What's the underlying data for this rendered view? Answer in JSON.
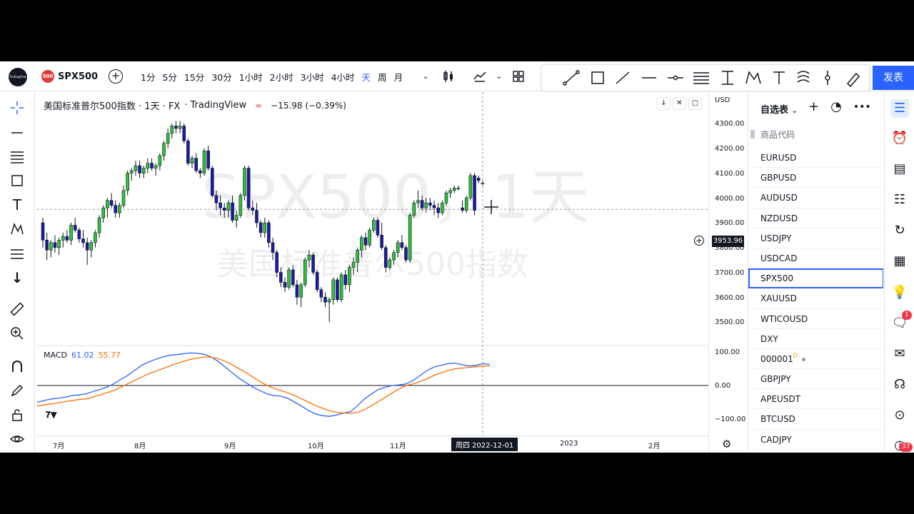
{
  "toolbar": {
    "logo_text": "TradingView",
    "symbol_badge": "500",
    "symbol": "SPX500",
    "intervals": [
      "1分",
      "5分",
      "15分",
      "30分",
      "1小时",
      "2小时",
      "3小时",
      "4小时",
      "天",
      "周",
      "月"
    ],
    "active_interval": "天",
    "publish_label": "发表"
  },
  "legend": {
    "title": "美国标准普尔500指数 · 1天 · FX",
    "source": "· TradingView",
    "change": "−15.98 (−0.39%)"
  },
  "watermark": {
    "line1": "SPX500，1天",
    "line2": "美国标准普尔500指数"
  },
  "macd": {
    "label": "MACD",
    "macd_value": "61.02",
    "signal_value": "55.77"
  },
  "price_axis": {
    "currency": "USD",
    "labels": [
      "4300.00",
      "4200.00",
      "4100.00",
      "4000.00",
      "3900.00",
      "3800.00",
      "3700.00",
      "3600.00",
      "3500.00"
    ],
    "current_price": "3953.96",
    "macd_labels": [
      "100.00",
      "0.00",
      "−100.00"
    ]
  },
  "time_axis": {
    "labels": [
      "7月",
      "8月",
      "9月",
      "10月",
      "11月",
      "2023",
      "2月"
    ],
    "crosshair_label": "周四 2022-12-01"
  },
  "watchlist": {
    "title": "自选表",
    "column_header": "商品代码",
    "items": [
      "EURUSD",
      "GBPUSD",
      "AUDUSD",
      "NZDUSD",
      "USDJPY",
      "USDCAD",
      "SPX500",
      "XAUUSD",
      "WTICOUSD",
      "DXY",
      "000001",
      "GBPJPY",
      "APEUSDT",
      "BTCUSD",
      "CADJPY"
    ],
    "selected": "SPX500",
    "flag_item_label": "D"
  },
  "rail": {
    "chat_badge": "1",
    "notif_badge": "37"
  },
  "colors": {
    "up": "#2ec338",
    "down": "#1a1aa6",
    "accent": "#2962ff",
    "macd": "#2962ff",
    "signal": "#ff6d00"
  },
  "chart_data": {
    "type": "candlestick",
    "title": "美国标准普尔500指数 · 1天 · FX",
    "ylim": [
      3450,
      4350
    ],
    "candles": [
      [
        3900,
        3920,
        3800,
        3830
      ],
      [
        3830,
        3860,
        3750,
        3790
      ],
      [
        3790,
        3830,
        3760,
        3820
      ],
      [
        3820,
        3850,
        3780,
        3800
      ],
      [
        3800,
        3840,
        3770,
        3830
      ],
      [
        3830,
        3860,
        3800,
        3845
      ],
      [
        3845,
        3870,
        3820,
        3830
      ],
      [
        3830,
        3900,
        3810,
        3890
      ],
      [
        3890,
        3920,
        3860,
        3870
      ],
      [
        3870,
        3880,
        3820,
        3835
      ],
      [
        3835,
        3870,
        3800,
        3820
      ],
      [
        3820,
        3840,
        3730,
        3790
      ],
      [
        3790,
        3830,
        3760,
        3820
      ],
      [
        3820,
        3870,
        3800,
        3860
      ],
      [
        3860,
        3930,
        3840,
        3920
      ],
      [
        3920,
        3970,
        3900,
        3960
      ],
      [
        3960,
        4000,
        3920,
        3990
      ],
      [
        3990,
        4020,
        3960,
        3970
      ],
      [
        3970,
        3990,
        3920,
        3940
      ],
      [
        3940,
        3980,
        3920,
        3970
      ],
      [
        3970,
        4050,
        3960,
        4030
      ],
      [
        4030,
        4110,
        4010,
        4100
      ],
      [
        4100,
        4120,
        4070,
        4110
      ],
      [
        4110,
        4150,
        4090,
        4130
      ],
      [
        4130,
        4150,
        4080,
        4100
      ],
      [
        4100,
        4130,
        4080,
        4120
      ],
      [
        4120,
        4160,
        4100,
        4140
      ],
      [
        4140,
        4160,
        4110,
        4120
      ],
      [
        4120,
        4140,
        4090,
        4130
      ],
      [
        4130,
        4180,
        4110,
        4170
      ],
      [
        4170,
        4230,
        4150,
        4220
      ],
      [
        4220,
        4280,
        4200,
        4260
      ],
      [
        4260,
        4300,
        4240,
        4290
      ],
      [
        4290,
        4310,
        4260,
        4280
      ],
      [
        4280,
        4310,
        4260,
        4290
      ],
      [
        4290,
        4300,
        4220,
        4230
      ],
      [
        4230,
        4240,
        4130,
        4140
      ],
      [
        4140,
        4170,
        4120,
        4160
      ],
      [
        4160,
        4180,
        4100,
        4110
      ],
      [
        4110,
        4120,
        4080,
        4100
      ],
      [
        4100,
        4200,
        4090,
        4190
      ],
      [
        4190,
        4210,
        4110,
        4120
      ],
      [
        4120,
        4130,
        4000,
        4010
      ],
      [
        4010,
        4030,
        3950,
        3980
      ],
      [
        3980,
        4010,
        3930,
        3960
      ],
      [
        3960,
        3980,
        3920,
        3950
      ],
      [
        3950,
        3990,
        3920,
        3980
      ],
      [
        3980,
        4010,
        3900,
        3910
      ],
      [
        3910,
        3950,
        3880,
        3930
      ],
      [
        3930,
        4020,
        3920,
        4010
      ],
      [
        4010,
        4130,
        3990,
        4120
      ],
      [
        4120,
        4130,
        3950,
        3960
      ],
      [
        3960,
        3990,
        3930,
        3950
      ],
      [
        3950,
        3980,
        3880,
        3900
      ],
      [
        3900,
        3910,
        3840,
        3860
      ],
      [
        3860,
        3920,
        3840,
        3900
      ],
      [
        3900,
        3910,
        3800,
        3820
      ],
      [
        3820,
        3840,
        3750,
        3780
      ],
      [
        3780,
        3790,
        3680,
        3700
      ],
      [
        3700,
        3720,
        3640,
        3660
      ],
      [
        3660,
        3680,
        3620,
        3640
      ],
      [
        3640,
        3720,
        3630,
        3710
      ],
      [
        3710,
        3730,
        3640,
        3650
      ],
      [
        3650,
        3670,
        3570,
        3600
      ],
      [
        3600,
        3660,
        3560,
        3650
      ],
      [
        3650,
        3760,
        3640,
        3750
      ],
      [
        3750,
        3790,
        3720,
        3770
      ],
      [
        3770,
        3780,
        3690,
        3700
      ],
      [
        3700,
        3710,
        3620,
        3630
      ],
      [
        3630,
        3640,
        3580,
        3600
      ],
      [
        3600,
        3620,
        3560,
        3580
      ],
      [
        3580,
        3600,
        3500,
        3590
      ],
      [
        3590,
        3680,
        3570,
        3670
      ],
      [
        3670,
        3680,
        3580,
        3590
      ],
      [
        3590,
        3700,
        3580,
        3690
      ],
      [
        3690,
        3710,
        3630,
        3650
      ],
      [
        3650,
        3730,
        3620,
        3720
      ],
      [
        3720,
        3760,
        3690,
        3740
      ],
      [
        3740,
        3800,
        3700,
        3790
      ],
      [
        3790,
        3850,
        3760,
        3840
      ],
      [
        3840,
        3860,
        3790,
        3810
      ],
      [
        3810,
        3880,
        3800,
        3870
      ],
      [
        3870,
        3920,
        3860,
        3910
      ],
      [
        3910,
        3920,
        3840,
        3850
      ],
      [
        3850,
        3900,
        3790,
        3800
      ],
      [
        3800,
        3810,
        3700,
        3720
      ],
      [
        3720,
        3760,
        3710,
        3750
      ],
      [
        3750,
        3790,
        3730,
        3780
      ],
      [
        3780,
        3830,
        3760,
        3820
      ],
      [
        3820,
        3850,
        3790,
        3800
      ],
      [
        3800,
        3810,
        3740,
        3750
      ],
      [
        3750,
        3940,
        3740,
        3930
      ],
      [
        3930,
        3990,
        3920,
        3980
      ],
      [
        3980,
        4030,
        3960,
        3990
      ],
      [
        3990,
        4010,
        3950,
        3960
      ],
      [
        3960,
        4000,
        3940,
        3980
      ],
      [
        3980,
        4000,
        3950,
        3970
      ],
      [
        3970,
        3990,
        3930,
        3960
      ],
      [
        3960,
        3980,
        3920,
        3940
      ],
      [
        3940,
        3990,
        3930,
        3980
      ],
      [
        3980,
        4030,
        3970,
        4020
      ],
      [
        4020,
        4040,
        4000,
        4030
      ],
      [
        4030,
        4050,
        4020,
        4040
      ],
      [
        4040,
        4050,
        4030,
        4040
      ],
      [
        3960,
        3990,
        3940,
        3950
      ],
      [
        3950,
        4010,
        3940,
        4000
      ],
      [
        4000,
        4100,
        3990,
        4090
      ],
      [
        4090,
        4100,
        3930,
        3950
      ],
      [
        4080,
        4090,
        4060,
        4070
      ],
      [
        4060,
        4070,
        4050,
        4060
      ]
    ],
    "macd_series": [
      {
        "name": "MACD",
        "values": [
          -50,
          -45,
          -40,
          -38,
          -35,
          -30,
          -28,
          -25,
          -18,
          -12,
          -5,
          5,
          18,
          30,
          45,
          60,
          70,
          78,
          85,
          90,
          92,
          95,
          97,
          96,
          93,
          85,
          72,
          55,
          38,
          22,
          8,
          -5,
          -15,
          -25,
          -30,
          -32,
          -38,
          -50,
          -62,
          -75,
          -85,
          -90,
          -92,
          -88,
          -82,
          -78,
          -60,
          -40,
          -25,
          -12,
          -5,
          0,
          2,
          5,
          15,
          30,
          45,
          55,
          60,
          65,
          67,
          62,
          58,
          60,
          65,
          63
        ]
      },
      {
        "name": "Signal",
        "values": [
          -60,
          -58,
          -55,
          -52,
          -48,
          -45,
          -42,
          -40,
          -35,
          -28,
          -22,
          -15,
          -5,
          5,
          15,
          25,
          35,
          42,
          50,
          58,
          65,
          72,
          78,
          82,
          85,
          84,
          80,
          72,
          62,
          50,
          38,
          25,
          12,
          0,
          -8,
          -15,
          -22,
          -30,
          -40,
          -50,
          -60,
          -68,
          -75,
          -80,
          -82,
          -83,
          -80,
          -72,
          -60,
          -48,
          -35,
          -22,
          -10,
          0,
          5,
          12,
          20,
          30,
          38,
          45,
          50,
          52,
          54,
          56,
          58,
          58
        ]
      }
    ]
  }
}
